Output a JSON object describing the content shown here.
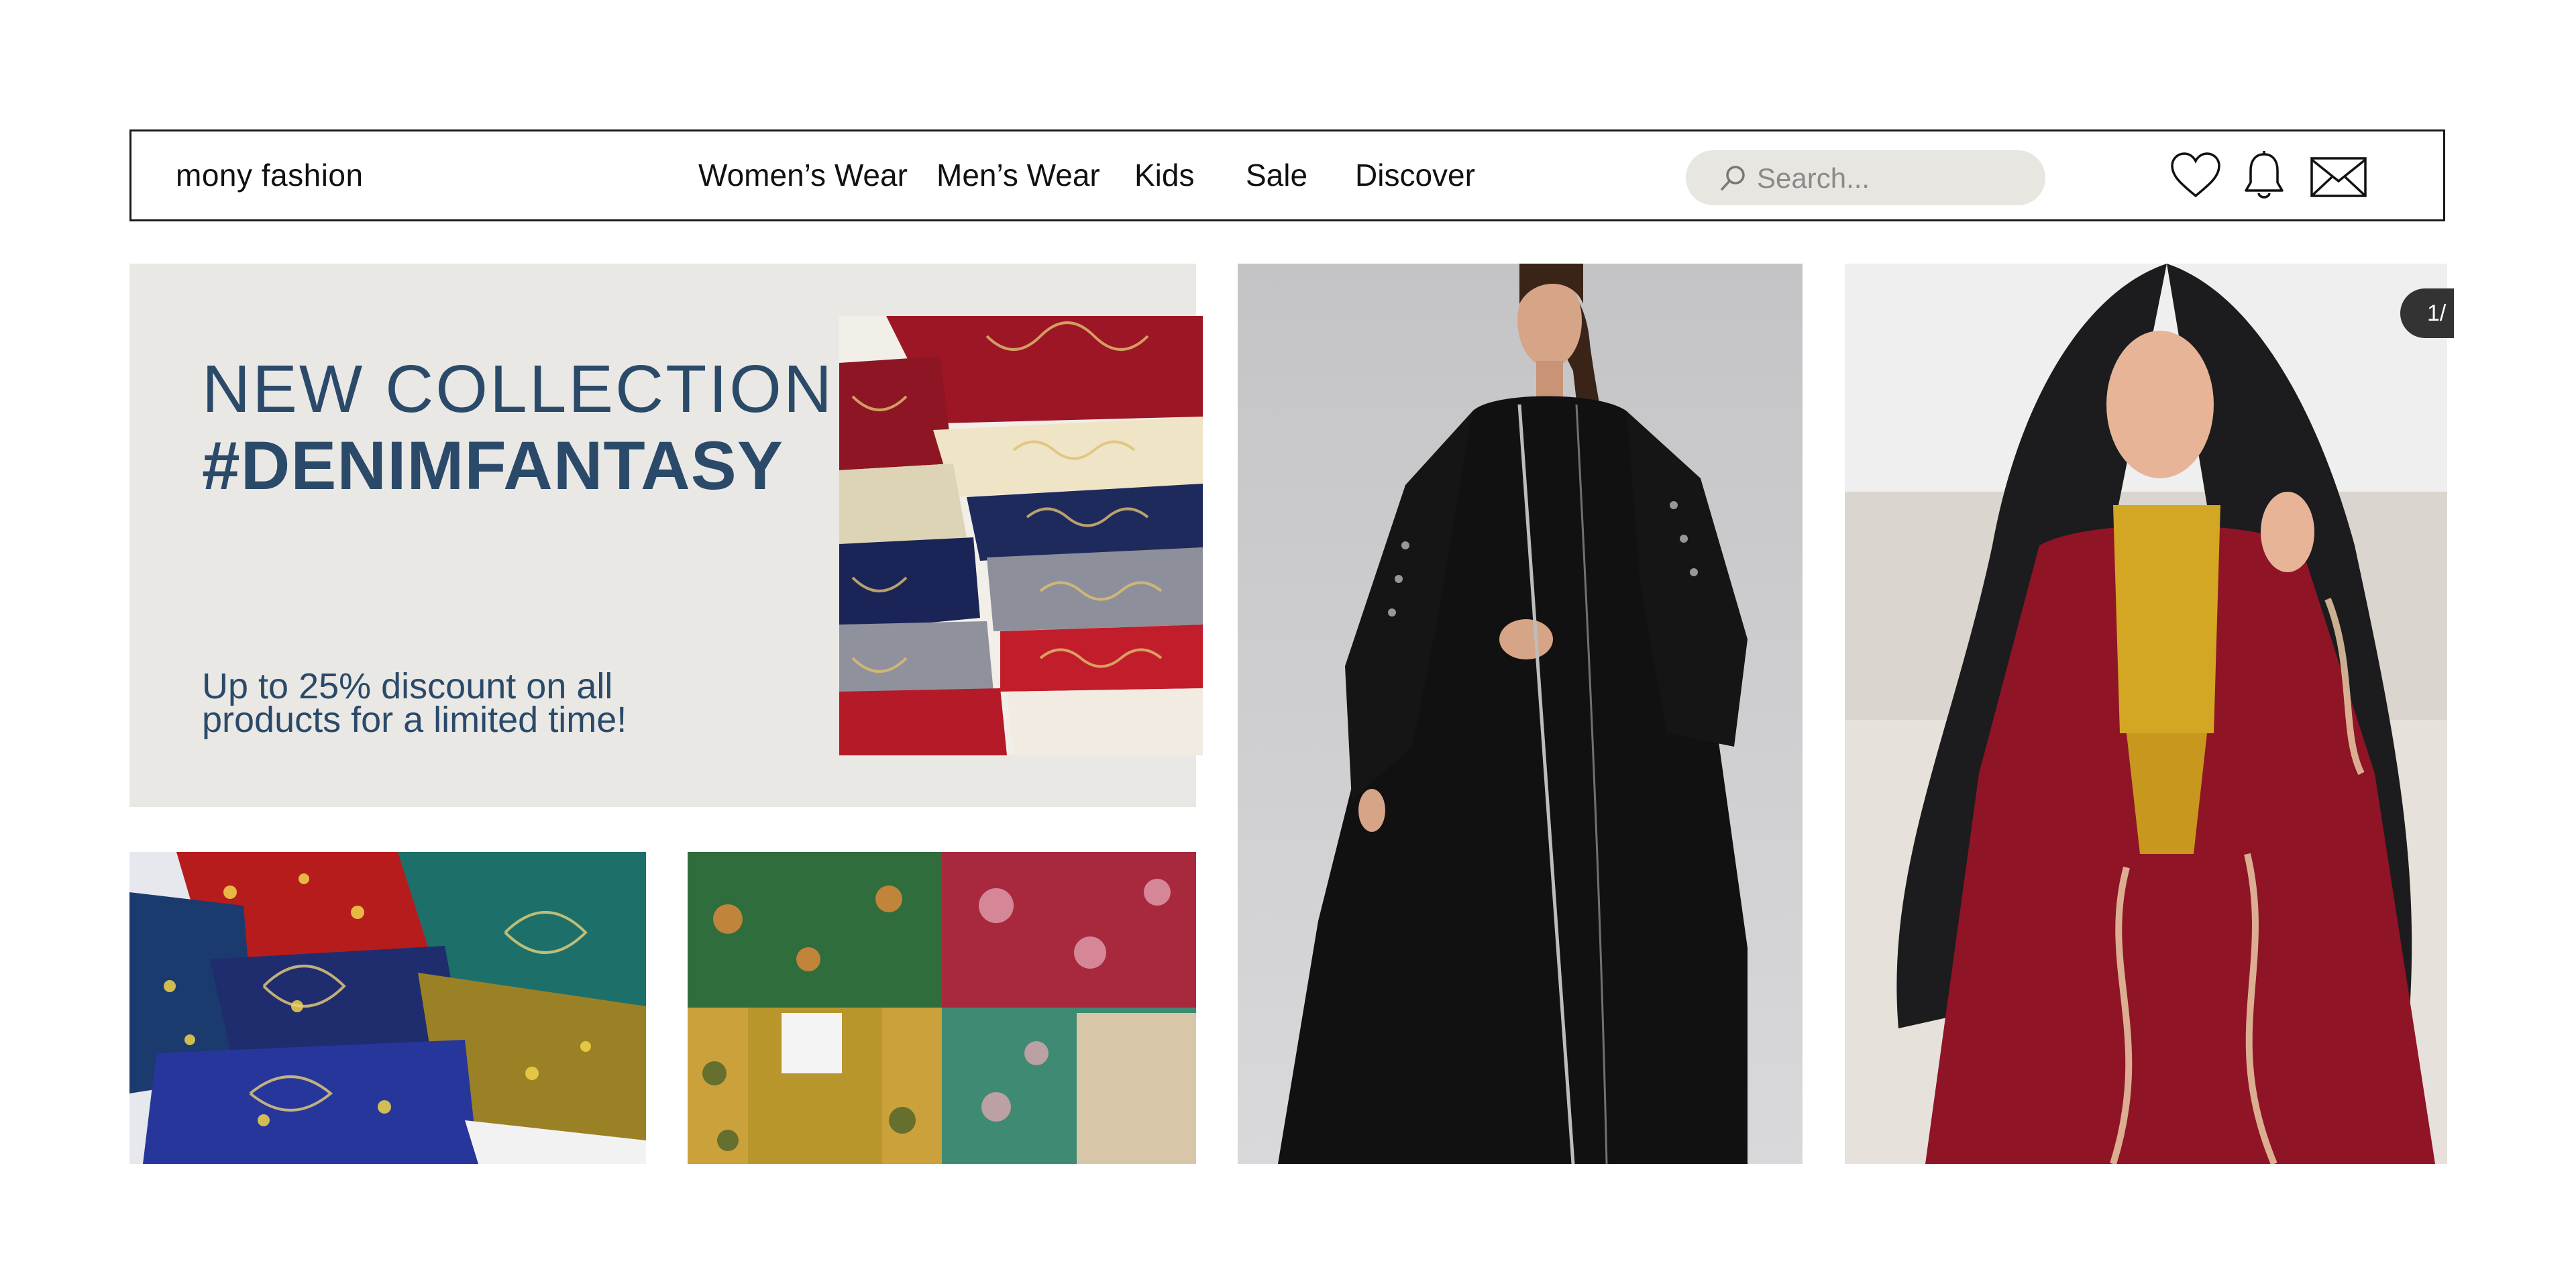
{
  "header": {
    "brand": "mony fashion",
    "nav": [
      "Women’s Wear",
      "Men’s Wear",
      "Kids",
      "Sale",
      "Discover"
    ],
    "search_placeholder": "Search...",
    "icons": [
      "heart-icon",
      "bell-icon",
      "mail-icon"
    ]
  },
  "promo": {
    "title_line1": "NEW COLLECTION:",
    "title_line2": "#DENIMFANTASY",
    "subtitle": "Up to 25% discount on all products for a limited time!"
  },
  "carousel": {
    "counter": "1/"
  },
  "colors": {
    "accent_text": "#2b4a6a",
    "promo_bg": "#e9e8e4",
    "search_bg": "#e8e6e1"
  }
}
